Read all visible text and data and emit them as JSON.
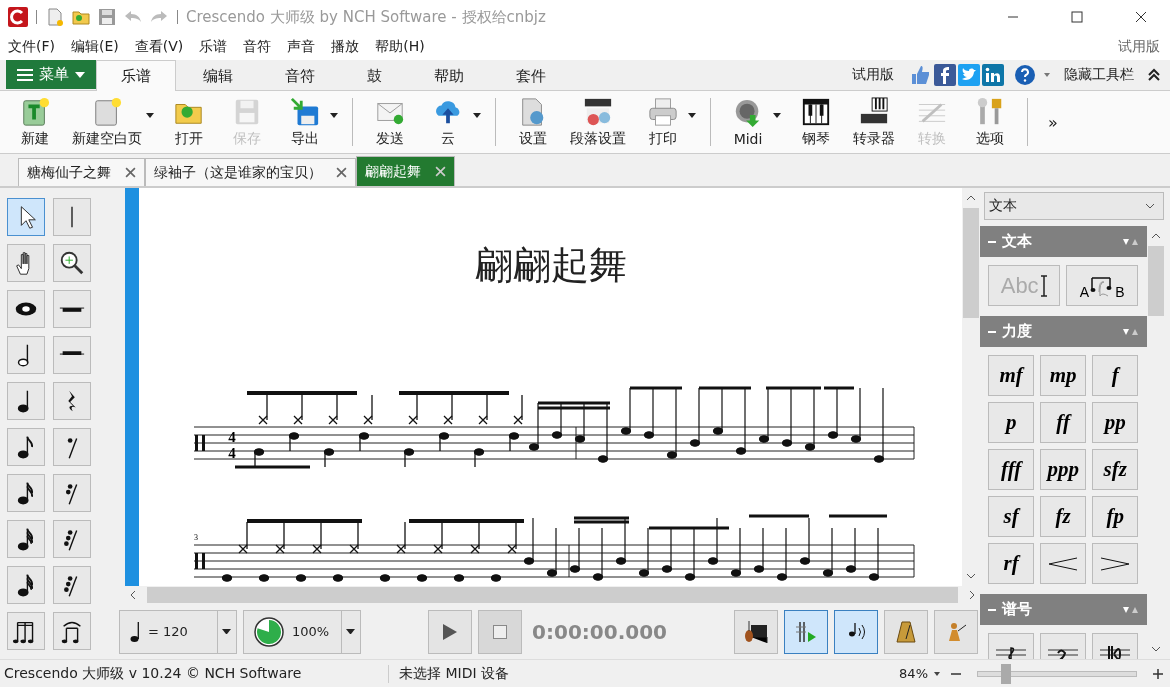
{
  "window": {
    "title": "Crescendo 大师级 by NCH Software - 授权给cnbjz"
  },
  "menu_bar": {
    "items": [
      "文件(F)",
      "编辑(E)",
      "查看(V)",
      "乐谱",
      "音符",
      "声音",
      "播放",
      "帮助(H)"
    ],
    "right_label": "试用版"
  },
  "ribbon": {
    "menu_button": "菜单",
    "tabs": [
      {
        "label": "乐谱",
        "selected": true
      },
      {
        "label": "编辑",
        "selected": false
      },
      {
        "label": "音符",
        "selected": false
      },
      {
        "label": "鼓",
        "selected": false
      },
      {
        "label": "帮助",
        "selected": false
      },
      {
        "label": "套件",
        "selected": false
      }
    ],
    "trial_label": "试用版",
    "hide_toolbar": "隐藏工具栏"
  },
  "toolbar": {
    "groups": [
      [
        {
          "kind": "new",
          "label": "新建",
          "disabled": false,
          "dropdown": false
        },
        {
          "kind": "new-blank",
          "label": "新建空白页",
          "disabled": false,
          "dropdown": true
        },
        {
          "kind": "open",
          "label": "打开",
          "disabled": false,
          "dropdown": false
        },
        {
          "kind": "save",
          "label": "保存",
          "disabled": true,
          "dropdown": false
        },
        {
          "kind": "export",
          "label": "导出",
          "disabled": false,
          "dropdown": true
        }
      ],
      [
        {
          "kind": "send",
          "label": "发送",
          "disabled": false,
          "dropdown": false
        },
        {
          "kind": "cloud",
          "label": "云",
          "disabled": false,
          "dropdown": true
        }
      ],
      [
        {
          "kind": "settings",
          "label": "设置",
          "disabled": false,
          "dropdown": false
        },
        {
          "kind": "layout",
          "label": "段落设置",
          "disabled": false,
          "dropdown": false
        },
        {
          "kind": "print",
          "label": "打印",
          "disabled": false,
          "dropdown": true
        }
      ],
      [
        {
          "kind": "midi",
          "label": "Midi",
          "disabled": false,
          "dropdown": true
        },
        {
          "kind": "piano",
          "label": "钢琴",
          "disabled": false,
          "dropdown": false
        },
        {
          "kind": "keys",
          "label": "转录器",
          "disabled": false,
          "dropdown": false
        },
        {
          "kind": "convert",
          "label": "转换",
          "disabled": true,
          "dropdown": false
        },
        {
          "kind": "options",
          "label": "选项",
          "disabled": false,
          "dropdown": false
        }
      ]
    ],
    "more": "»"
  },
  "doc_tabs": [
    {
      "label": "糖梅仙子之舞",
      "selected": false
    },
    {
      "label": "绿袖子（这是谁家的宝贝）",
      "selected": false
    },
    {
      "label": "翩翩起舞",
      "selected": true
    }
  ],
  "tool_palette": [
    {
      "kind": "pointer",
      "selected": true
    },
    {
      "kind": "line",
      "selected": false
    },
    {
      "kind": "hand",
      "selected": false
    },
    {
      "kind": "zoom",
      "selected": false
    },
    {
      "kind": "whole-note",
      "selected": false
    },
    {
      "kind": "whole-rest",
      "selected": false
    },
    {
      "kind": "half-note",
      "selected": false
    },
    {
      "kind": "half-rest",
      "selected": false
    },
    {
      "kind": "quarter-note",
      "selected": false
    },
    {
      "kind": "quarter-rest",
      "selected": false
    },
    {
      "kind": "eighth-note",
      "selected": false
    },
    {
      "kind": "eighth-rest",
      "selected": false
    },
    {
      "kind": "sixteenth-note",
      "selected": false
    },
    {
      "kind": "sixteenth-rest",
      "selected": false
    },
    {
      "kind": "thirty-second-note",
      "selected": false
    },
    {
      "kind": "thirty-second-rest",
      "selected": false
    },
    {
      "kind": "sixty-fourth-note",
      "selected": false
    },
    {
      "kind": "sixty-fourth-rest",
      "selected": false
    },
    {
      "kind": "triplet",
      "selected": false
    },
    {
      "kind": "beamed",
      "selected": false
    }
  ],
  "score": {
    "title": "翩翩起舞",
    "time_signature": [
      "4",
      "4"
    ],
    "measure_number": "3"
  },
  "right_panel": {
    "dropdown": "文本",
    "sections": [
      {
        "title": "文本",
        "expanded": true,
        "items": [
          {
            "kind": "text-tool",
            "label": "Abc"
          },
          {
            "kind": "lyric-tool",
            "labels": [
              "A",
              "B"
            ]
          }
        ]
      },
      {
        "title": "力度",
        "expanded": true,
        "items": [
          {
            "kind": "mark",
            "label": "mf"
          },
          {
            "kind": "mark",
            "label": "mp"
          },
          {
            "kind": "mark",
            "label": "f"
          },
          {
            "kind": "mark",
            "label": "p"
          },
          {
            "kind": "mark",
            "label": "ff"
          },
          {
            "kind": "mark",
            "label": "pp"
          },
          {
            "kind": "mark",
            "label": "fff"
          },
          {
            "kind": "mark",
            "label": "ppp"
          },
          {
            "kind": "mark",
            "label": "sfz"
          },
          {
            "kind": "mark",
            "label": "sf"
          },
          {
            "kind": "mark",
            "label": "fz"
          },
          {
            "kind": "mark",
            "label": "fp"
          },
          {
            "kind": "mark",
            "label": "rf"
          },
          {
            "kind": "crescendo"
          },
          {
            "kind": "decrescendo"
          }
        ]
      },
      {
        "title": "谱号",
        "expanded": true,
        "items": [
          {
            "kind": "treble-clef"
          },
          {
            "kind": "bass-clef"
          },
          {
            "kind": "alto-clef"
          }
        ]
      }
    ]
  },
  "transport": {
    "tempo": "= 120",
    "speed": "100%",
    "speed_dial": {
      "level": 0.8
    },
    "time": "0:00:00.000",
    "toggles": [
      {
        "kind": "instruments",
        "on": false
      },
      {
        "kind": "scroll",
        "on": true
      },
      {
        "kind": "sound",
        "on": true
      },
      {
        "kind": "metronome",
        "on": false
      },
      {
        "kind": "conductor",
        "on": false
      }
    ]
  },
  "status_bar": {
    "app": "Crescendo 大师级 v 10.24 © NCH Software",
    "midi": "未选择 MIDI 设备",
    "zoom": "84%",
    "zoom_slider": {
      "level": 0.2
    }
  }
}
